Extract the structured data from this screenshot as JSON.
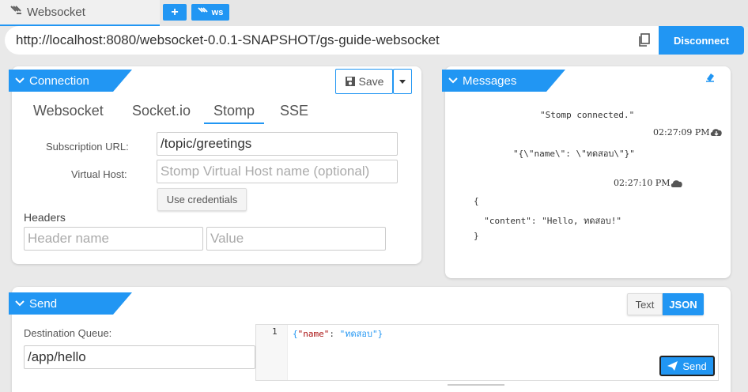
{
  "tab": {
    "title": "Websocket",
    "add_label": "+",
    "ws_label": "ws"
  },
  "urlbar": {
    "url": "http://localhost:8080/websocket-0.0.1-SNAPSHOT/gs-guide-websocket",
    "disconnect_label": "Disconnect"
  },
  "connection": {
    "title": "Connection",
    "save_label": "Save",
    "tabs": [
      "Websocket",
      "Socket.io",
      "Stomp",
      "SSE"
    ],
    "active_tab": "Stomp",
    "subscription_label": "Subscription URL:",
    "subscription_value": "/topic/greetings",
    "vhost_label": "Virtual Host:",
    "vhost_placeholder": "Stomp Virtual Host name (optional)",
    "credentials_label": "Use credentials",
    "headers_label": "Headers",
    "header_name_placeholder": "Header name",
    "header_value_placeholder": "Value"
  },
  "messages": {
    "title": "Messages",
    "items": [
      {
        "text": "\"Stomp connected.\"",
        "time": "02:27:09 PM",
        "direction": "received"
      },
      {
        "text": "\"{\\\"name\\\": \\\"ทดสอบ\\\"}\"",
        "time": "02:27:10 PM",
        "direction": "sent"
      },
      {
        "lines": [
          "{",
          "  \"content\": \"Hello, ทดสอบ!\"",
          "}"
        ]
      }
    ]
  },
  "send": {
    "title": "Send",
    "format_options": [
      "Text",
      "JSON"
    ],
    "active_format": "JSON",
    "destination_label": "Destination Queue:",
    "destination_value": "/app/hello",
    "editor_line_number": "1",
    "editor_key": "\"name\"",
    "editor_value": "\"ทดสอบ\"",
    "send_label": "Send"
  },
  "colors": {
    "accent": "#2196f3",
    "json_key": "#a11",
    "json_string": "#2196f3"
  }
}
